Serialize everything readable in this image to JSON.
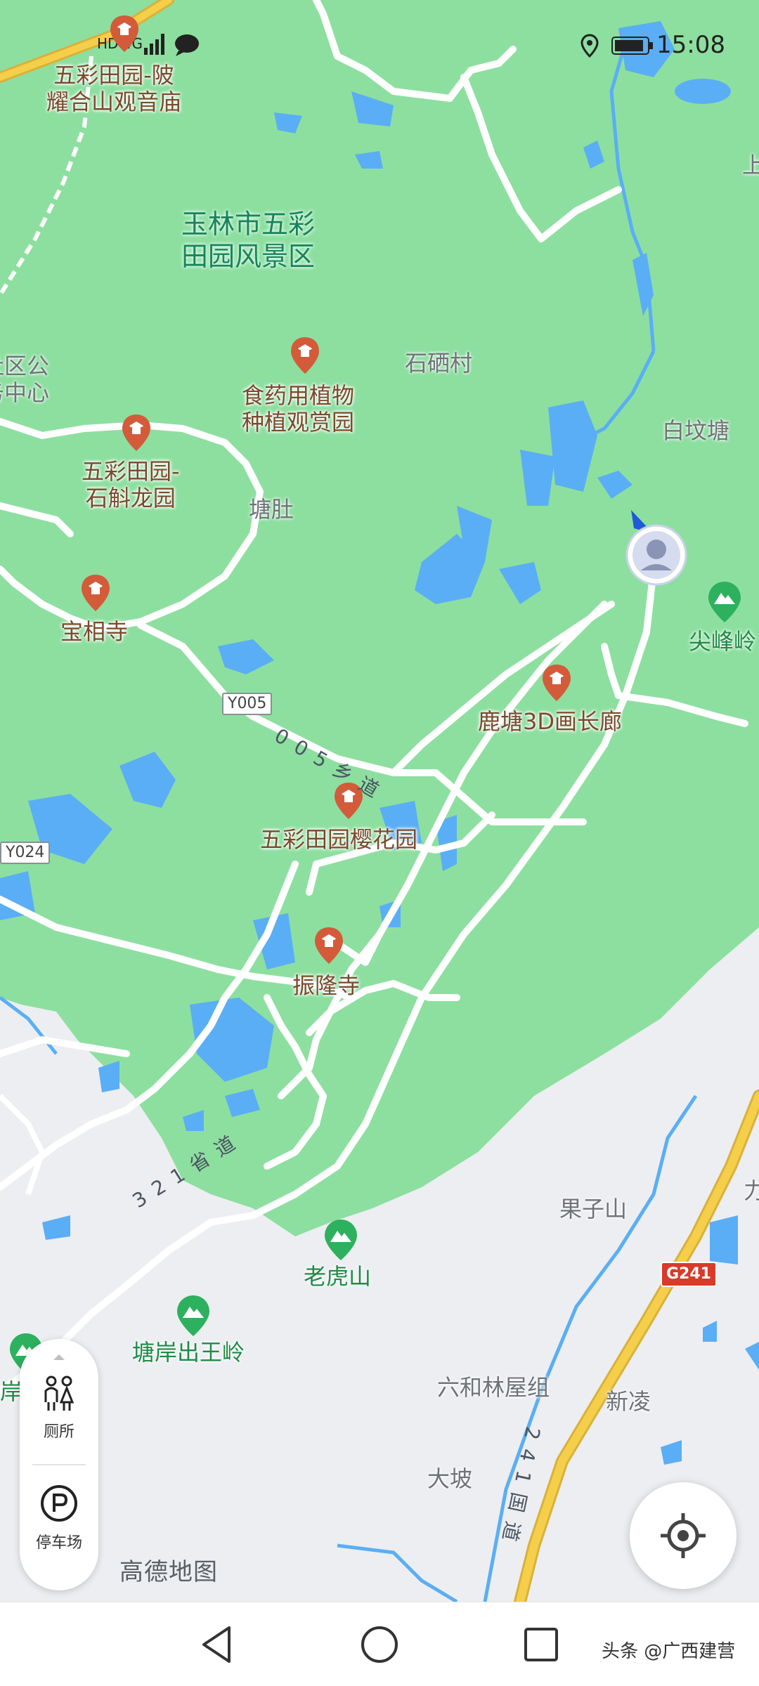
{
  "status_bar": {
    "time": "15:08",
    "network": "HD 4G",
    "icons": [
      "signal-icon",
      "message-icon",
      "location-icon",
      "battery-icon"
    ]
  },
  "map": {
    "scenic_area": "玉林市五彩\n田园风景区",
    "pois": [
      {
        "id": "guanyin",
        "label": "五彩田园-陂\n耀合山观音庙"
      },
      {
        "id": "herb",
        "label": "食药用植物\n种植观赏园"
      },
      {
        "id": "shihu",
        "label": "五彩田园-\n石斛龙园"
      },
      {
        "id": "baoxiang",
        "label": "宝相寺"
      },
      {
        "id": "gallery",
        "label": "鹿塘3D画长廊"
      },
      {
        "id": "sakura",
        "label": "五彩田园樱花园"
      },
      {
        "id": "zhenlong",
        "label": "振隆寺"
      }
    ],
    "villages": [
      {
        "id": "shigang",
        "label": "石硒村"
      },
      {
        "id": "baifentang",
        "label": "白坟塘"
      },
      {
        "id": "tangdu",
        "label": "塘肚"
      },
      {
        "id": "guozishan",
        "label": "果子山"
      },
      {
        "id": "liuhelin",
        "label": "六和林屋组"
      },
      {
        "id": "xinling",
        "label": "新凌"
      },
      {
        "id": "dapo",
        "label": "大坡"
      },
      {
        "id": "service",
        "label": "社区公\n务中心"
      },
      {
        "id": "edge-right",
        "label": "上"
      },
      {
        "id": "edge-right2",
        "label": "力"
      }
    ],
    "peaks": [
      {
        "id": "jianfeng",
        "label": "尖峰岭"
      },
      {
        "id": "laohu",
        "label": "老虎山"
      },
      {
        "id": "chuwang",
        "label": "塘岸出王岭"
      },
      {
        "id": "edge-left",
        "label": "岸"
      }
    ],
    "road_tags": [
      {
        "id": "y005",
        "label": "Y005"
      },
      {
        "id": "y024",
        "label": "Y024"
      },
      {
        "id": "g241",
        "label": "G241"
      }
    ],
    "road_names": [
      {
        "id": "xiangdao",
        "label": "005乡道"
      },
      {
        "id": "shengdao",
        "label": "321省道"
      },
      {
        "id": "guodao",
        "label": "241国道"
      }
    ]
  },
  "side_panel": {
    "toilet_label": "厕所",
    "parking_label": "停车场"
  },
  "brand": "高德地图",
  "watermark": "头条 @广西建营",
  "colors": {
    "park_green": "#8ddfa0",
    "water": "#5aaef5",
    "road": "#ffffff",
    "highway": "#f5cf4a",
    "land": "#eceef1",
    "poi_pin": "#d35b3a",
    "peak_pin": "#2db15e"
  }
}
